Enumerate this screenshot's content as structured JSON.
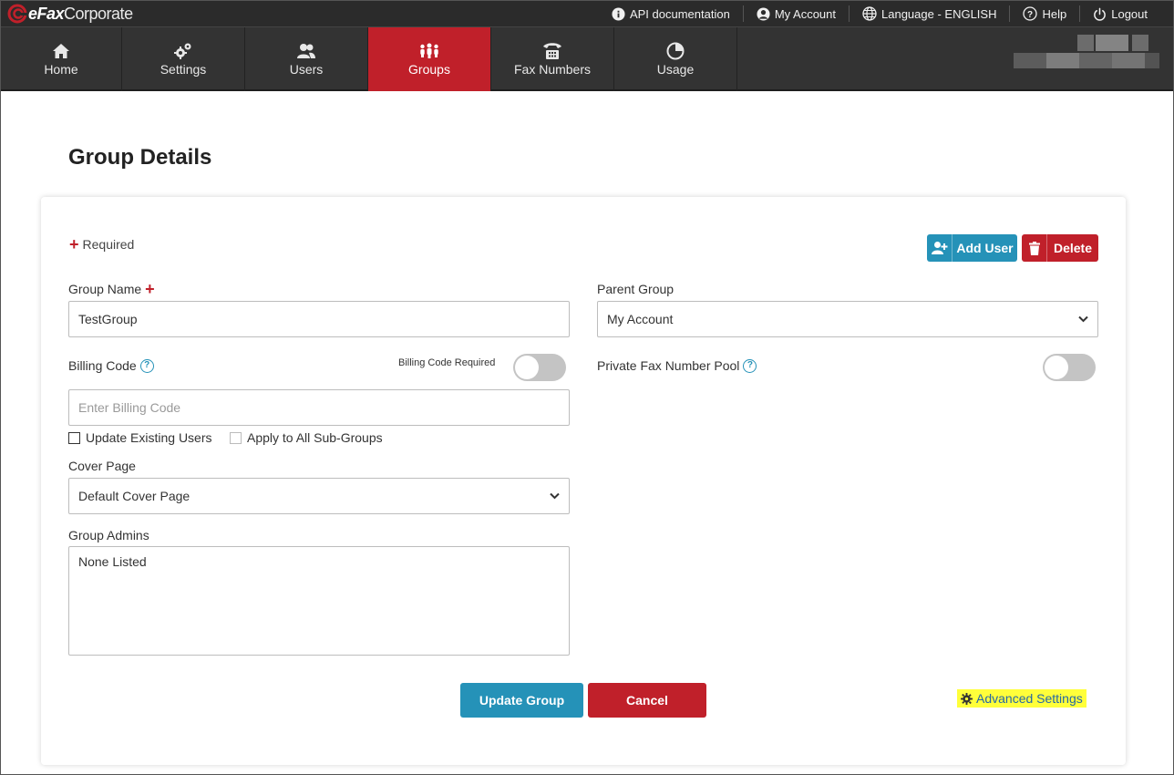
{
  "brand": {
    "name_bold": "eFax",
    "name_light": "Corporate",
    "accent": "#c0202a"
  },
  "utility_links": [
    {
      "icon": "info-icon",
      "label": "API documentation"
    },
    {
      "icon": "user-circle-icon",
      "label": "My Account"
    },
    {
      "icon": "globe-icon",
      "label": "Language - ENGLISH"
    },
    {
      "icon": "help-circle-icon",
      "label": "Help"
    },
    {
      "icon": "power-icon",
      "label": "Logout"
    }
  ],
  "nav": {
    "tabs": [
      {
        "icon": "home-icon",
        "label": "Home"
      },
      {
        "icon": "gears-icon",
        "label": "Settings"
      },
      {
        "icon": "users-icon",
        "label": "Users"
      },
      {
        "icon": "groups-icon",
        "label": "Groups",
        "active": true
      },
      {
        "icon": "phone-icon",
        "label": "Fax Numbers"
      },
      {
        "icon": "pie-chart-icon",
        "label": "Usage"
      }
    ]
  },
  "page": {
    "title": "Group Details"
  },
  "form": {
    "required_note": "Required",
    "add_user_label": "Add User",
    "delete_label": "Delete",
    "group_name": {
      "label": "Group Name",
      "value": "TestGroup"
    },
    "parent_group": {
      "label": "Parent Group",
      "value": "My Account"
    },
    "billing_code": {
      "label": "Billing Code",
      "required_label": "Billing Code Required",
      "required_on": false,
      "placeholder": "Enter Billing Code"
    },
    "private_pool": {
      "label": "Private Fax Number Pool",
      "on": false
    },
    "update_existing_users": {
      "label": "Update Existing Users",
      "checked": false
    },
    "apply_sub_groups": {
      "label": "Apply to All Sub-Groups",
      "checked": false
    },
    "cover_page": {
      "label": "Cover Page",
      "value": "Default Cover Page"
    },
    "group_admins": {
      "label": "Group Admins",
      "value": "None Listed"
    },
    "update_label": "Update Group",
    "cancel_label": "Cancel",
    "advanced_label": "Advanced Settings"
  }
}
